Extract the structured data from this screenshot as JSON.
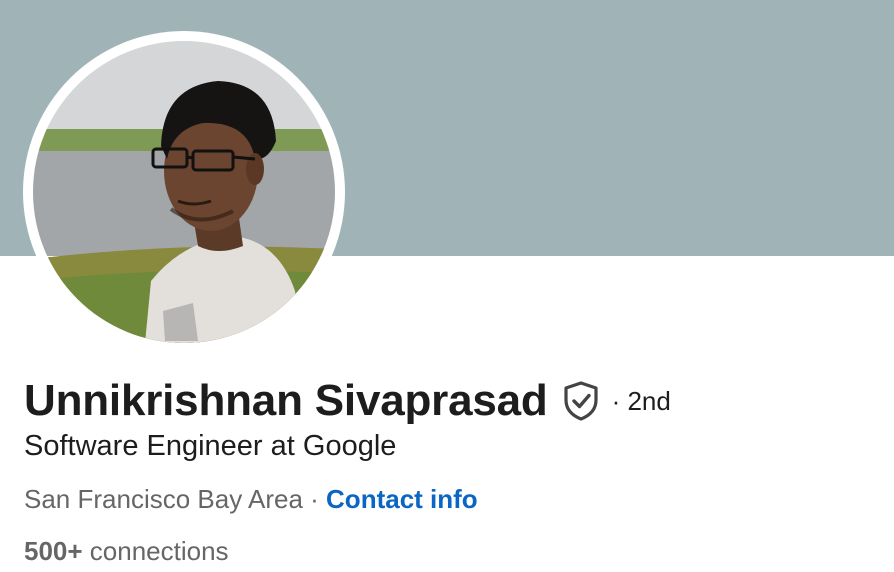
{
  "profile": {
    "name": "Unnikrishnan Sivaprasad",
    "degree": "· 2nd",
    "headline": "Software Engineer at Google",
    "location": "San Francisco Bay Area",
    "separator": " · ",
    "contact_label": "Contact info",
    "connections_count": "500+",
    "connections_label": " connections"
  },
  "icons": {
    "verification": "shield-check-icon"
  },
  "colors": {
    "banner": "#a0b4b7",
    "link": "#0a66c2",
    "primary_text": "#1d1d1d",
    "secondary_text": "#666666"
  }
}
